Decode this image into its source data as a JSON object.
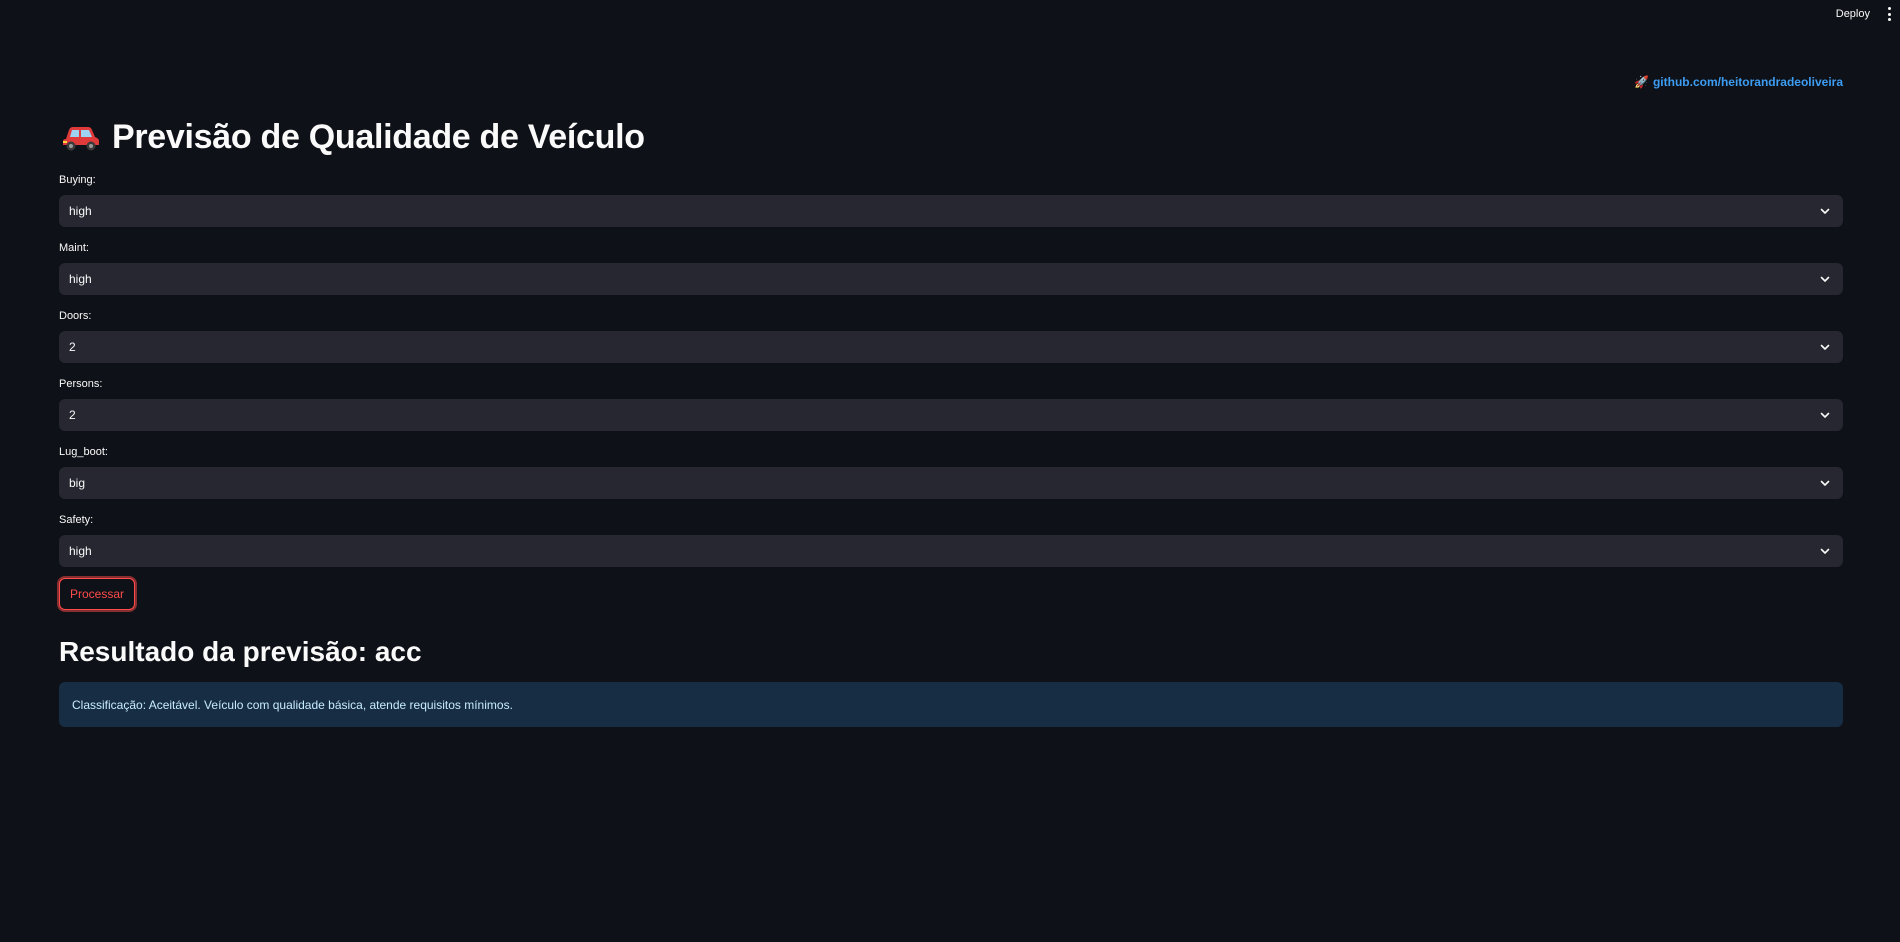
{
  "header": {
    "deploy_label": "Deploy",
    "menu_icon": "vertical-ellipsis-icon"
  },
  "github_link": {
    "icon": "🚀",
    "text": "github.com/heitorandradeoliveira"
  },
  "title": {
    "icon": "car-icon",
    "text": "Previsão de Qualidade de Veículo"
  },
  "fields": [
    {
      "label": "Buying:",
      "value": "high"
    },
    {
      "label": "Maint:",
      "value": "high"
    },
    {
      "label": "Doors:",
      "value": "2"
    },
    {
      "label": "Persons:",
      "value": "2"
    },
    {
      "label": "Lug_boot:",
      "value": "big"
    },
    {
      "label": "Safety:",
      "value": "high"
    }
  ],
  "process_button": {
    "label": "Processar"
  },
  "result": {
    "heading": "Resultado da previsão: acc",
    "info": "Classificação: Aceitável. Veículo com qualidade básica, atende requisitos mínimos."
  },
  "colors": {
    "background": "#0e1117",
    "input_background": "#262730",
    "accent": "#ff4b4b",
    "link": "#3d9df3",
    "info_background": "#172d43",
    "info_text": "#c7ebff",
    "car_body": "#e03a3a"
  }
}
